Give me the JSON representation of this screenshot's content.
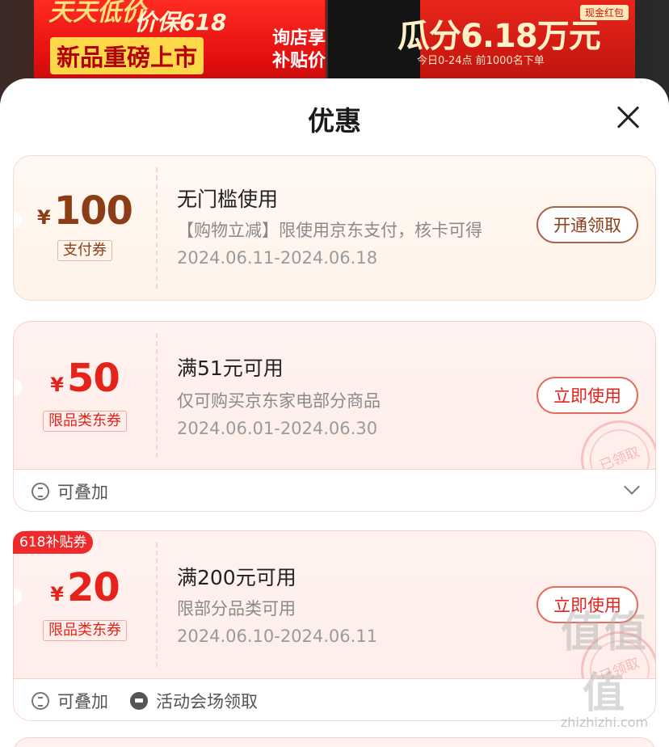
{
  "banner": {
    "top_text": "天天低价",
    "promise": "价保618",
    "new_tag": "新品重磅上市",
    "store_line1": "询店享",
    "store_line2": "补贴价",
    "cash_tag": "现金红包",
    "big_prize": "瓜分6.18万元",
    "note": "今日0-24点 前1000名下单"
  },
  "sheet": {
    "title": "优惠"
  },
  "coupons": [
    {
      "currency": "¥",
      "amount": "100",
      "type": "支付券",
      "title": "无门槛使用",
      "desc": "【购物立减】限使用京东支付，核卡可得",
      "date": "2024.06.11-2024.06.18",
      "action": "开通领取"
    },
    {
      "currency": "¥",
      "amount": "50",
      "type": "限品类东券",
      "title": "满51元可用",
      "desc": "仅可购买京东家电部分商品",
      "date": "2024.06.01-2024.06.30",
      "action": "立即使用",
      "stamp": "已领取",
      "footer": {
        "stackable": "可叠加"
      }
    },
    {
      "badge": "618补贴券",
      "currency": "¥",
      "amount": "20",
      "type": "限品类东券",
      "title": "满200元可用",
      "desc": "限部分品类可用",
      "date": "2024.06.10-2024.06.11",
      "action": "立即使用",
      "stamp": "已领取",
      "footer": {
        "stackable": "可叠加",
        "venue": "活动会场领取"
      }
    }
  ],
  "watermark": {
    "text": "值值值",
    "url": "zhizhizhi.com"
  }
}
